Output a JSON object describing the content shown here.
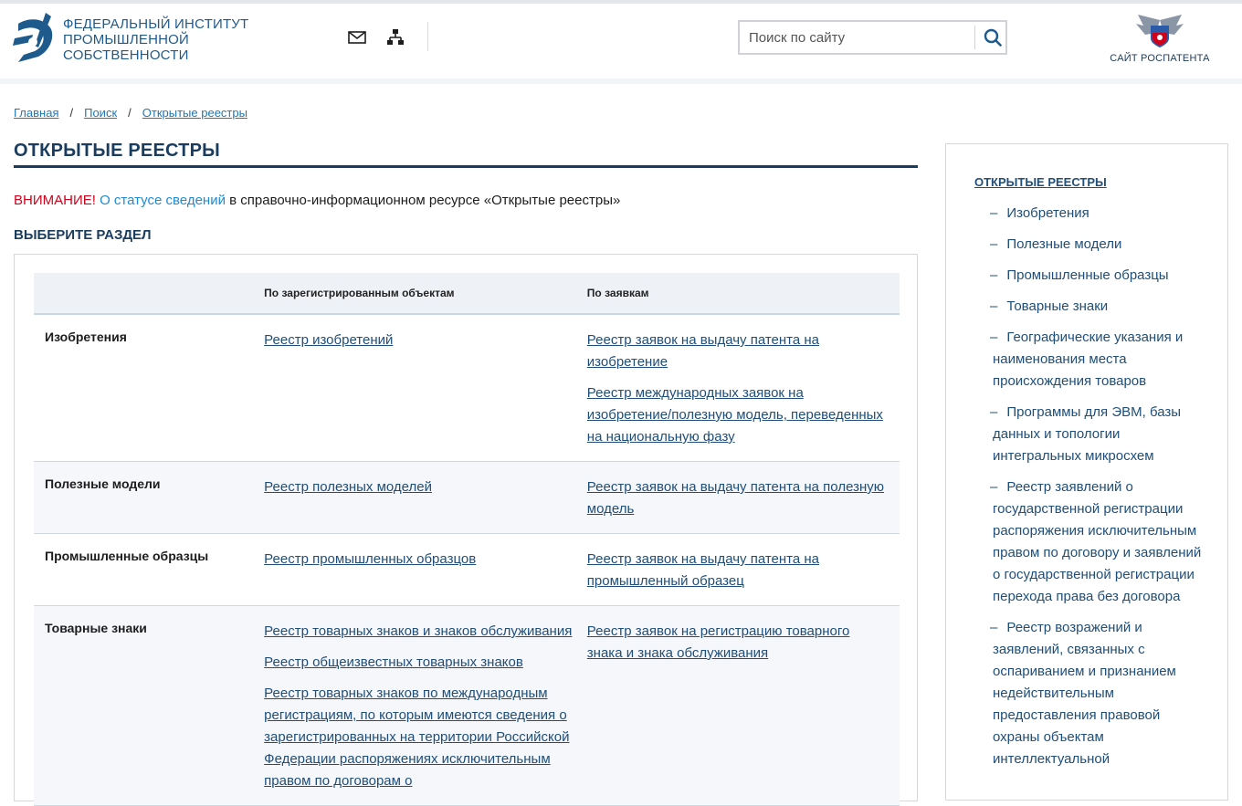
{
  "header": {
    "logo_lines": [
      "ФЕДЕРАЛЬНЫЙ ИНСТИТУТ",
      "ПРОМЫШЛЕННОЙ",
      "СОБСТВЕННОСТИ"
    ],
    "search_placeholder": "Поиск по сайту",
    "rospatent_label": "САЙТ РОСПАТЕНТА",
    "icons": [
      "mail-icon",
      "sitemap-icon",
      "search-icon"
    ]
  },
  "breadcrumb": [
    "Главная",
    "Поиск",
    "Открытые реестры"
  ],
  "page_title": "ОТКРЫТЫЕ РЕЕСТРЫ",
  "notice": {
    "warning": "ВНИМАНИЕ!",
    "link": "О статусе сведений",
    "text": " в справочно-информационном ресурсе «Открытые реестры»"
  },
  "section_title": "ВЫБЕРИТЕ РАЗДЕЛ",
  "table": {
    "headers": [
      "",
      "По зарегистрированным объектам",
      "По заявкам"
    ],
    "rows": [
      {
        "category": "Изобретения",
        "registered": [
          "Реестр изобретений"
        ],
        "applications": [
          "Реестр заявок на выдачу патента на изобретение",
          "Реестр международных заявок на изобретение/полезную модель, переведенных на национальную фазу"
        ]
      },
      {
        "category": "Полезные модели",
        "registered": [
          "Реестр полезных моделей"
        ],
        "applications": [
          "Реестр заявок на выдачу патента на полезную модель"
        ]
      },
      {
        "category": "Промышленные образцы",
        "registered": [
          "Реестр промышленных образцов"
        ],
        "applications": [
          "Реестр заявок на выдачу патента на промышленный образец"
        ]
      },
      {
        "category": "Товарные знаки",
        "registered": [
          "Реестр товарных знаков и знаков обслуживания",
          "Реестр общеизвестных товарных знаков",
          "Реестр товарных знаков по международным регистрациям, по которым имеются сведения о зарегистрированных на территории Российской Федерации распоряжениях исключительным правом по договорам о"
        ],
        "applications": [
          "Реестр заявок на регистрацию товарного знака и знака обслуживания"
        ]
      }
    ]
  },
  "sidebar": {
    "title": "ОТКРЫТЫЕ РЕЕСТРЫ",
    "dash": "–",
    "items": [
      "Изобретения",
      "Полезные модели",
      "Промышленные образцы",
      "Товарные знаки",
      "Географические указания и наименования места происхождения товаров",
      "Программы для ЭВМ, базы данных и топологии интегральных микросхем",
      "Реестр заявлений о государственной регистрации распоряжения исключительным правом по договору и заявлений о государственной регистрации перехода права без договора",
      "Реестр возражений и заявлений, связанных с оспариванием и признанием недействительным предоставления правовой охраны объектам интеллектуальной"
    ]
  },
  "colors": {
    "brand": "#1f5a8c",
    "title": "#1a3c5e",
    "link": "#1f4e79",
    "warning": "#d0021b",
    "notice_link": "#1f8bd1"
  }
}
